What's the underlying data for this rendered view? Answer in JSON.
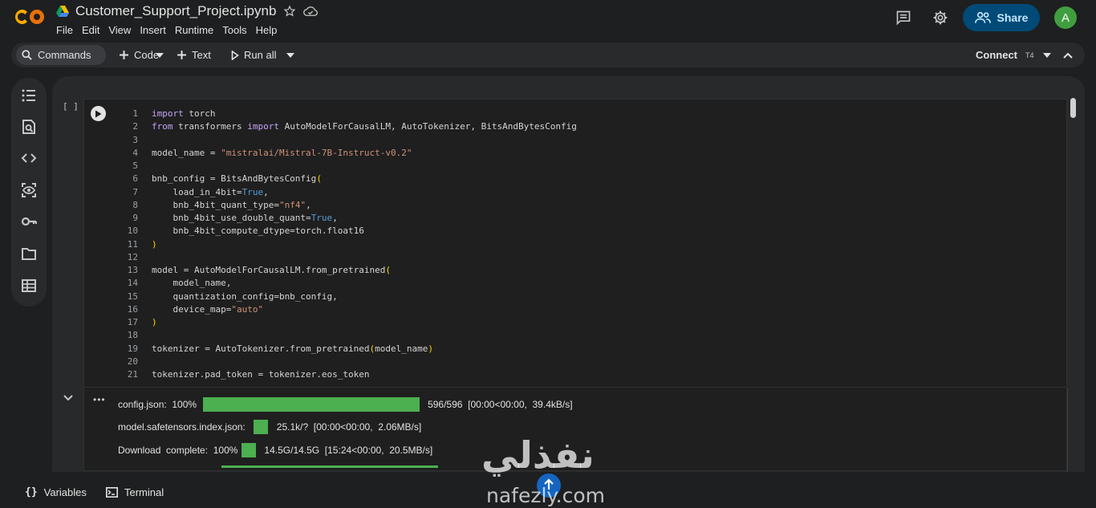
{
  "header": {
    "title": "Customer_Support_Project.ipynb",
    "menu": [
      "File",
      "Edit",
      "View",
      "Insert",
      "Runtime",
      "Tools",
      "Help"
    ],
    "share_label": "Share",
    "avatar_letter": "A"
  },
  "toolbar": {
    "commands_label": "Commands",
    "code_label": "Code",
    "text_label": "Text",
    "run_all_label": "Run all",
    "connect_label": "Connect",
    "runtime_type": "T4"
  },
  "cell": {
    "exec_marker": "[ ]",
    "line_numbers": [
      "1",
      "2",
      "3",
      "4",
      "5",
      "6",
      "7",
      "8",
      "9",
      "10",
      "11",
      "12",
      "13",
      "14",
      "15",
      "16",
      "17",
      "18",
      "19",
      "20",
      "21"
    ]
  },
  "output": {
    "rows": [
      {
        "label": "config.json:  100%",
        "progress": 1.0,
        "stats": "596/596  [00:00<00:00,  39.4kB/s]"
      },
      {
        "label": "model.safetensors.index.json:",
        "progress": 1.0,
        "stats": "25.1k/?  [00:00<00:00,  2.06MB/s]"
      },
      {
        "label": "Download  complete:  100%",
        "progress": 1.0,
        "stats": "14.5G/14.5G  [15:24<00:00,  20.5MB/s]"
      }
    ]
  },
  "bottom": {
    "variables_label": "Variables",
    "terminal_label": "Terminal"
  },
  "watermark": {
    "text": "نفذلي",
    "url": "nafezly.com"
  }
}
